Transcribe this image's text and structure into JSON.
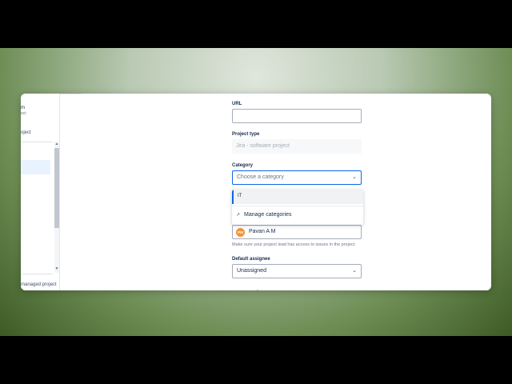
{
  "sidebar": {
    "title_fragment": "m",
    "subtitle_fragment": "ect",
    "section_fragment": "oject",
    "footer_fragment": "managed project",
    "scroll_up": "▲",
    "scroll_down": "▼"
  },
  "form": {
    "url": {
      "label": "URL",
      "value": ""
    },
    "project_type": {
      "label": "Project type",
      "value": "Jira - software project"
    },
    "category": {
      "label": "Category",
      "placeholder": "Choose a category",
      "options": [
        {
          "label": "IT",
          "highlighted": true
        },
        {
          "label": "Manage categories",
          "icon": "external-link-icon"
        }
      ]
    },
    "project_lead": {
      "initials": "PM",
      "name": "Pavan A M",
      "avatar_color": "#f79233",
      "help": "Make sure your project lead has access to issues in the project."
    },
    "default_assignee": {
      "label": "Default assignee",
      "value": "Unassigned"
    }
  },
  "icons": {
    "chevron": "chevron-down-icon",
    "manage": "external-link-icon"
  },
  "colors": {
    "accent": "#0c66e4",
    "text": "#172b4d",
    "muted": "#6b778c"
  }
}
